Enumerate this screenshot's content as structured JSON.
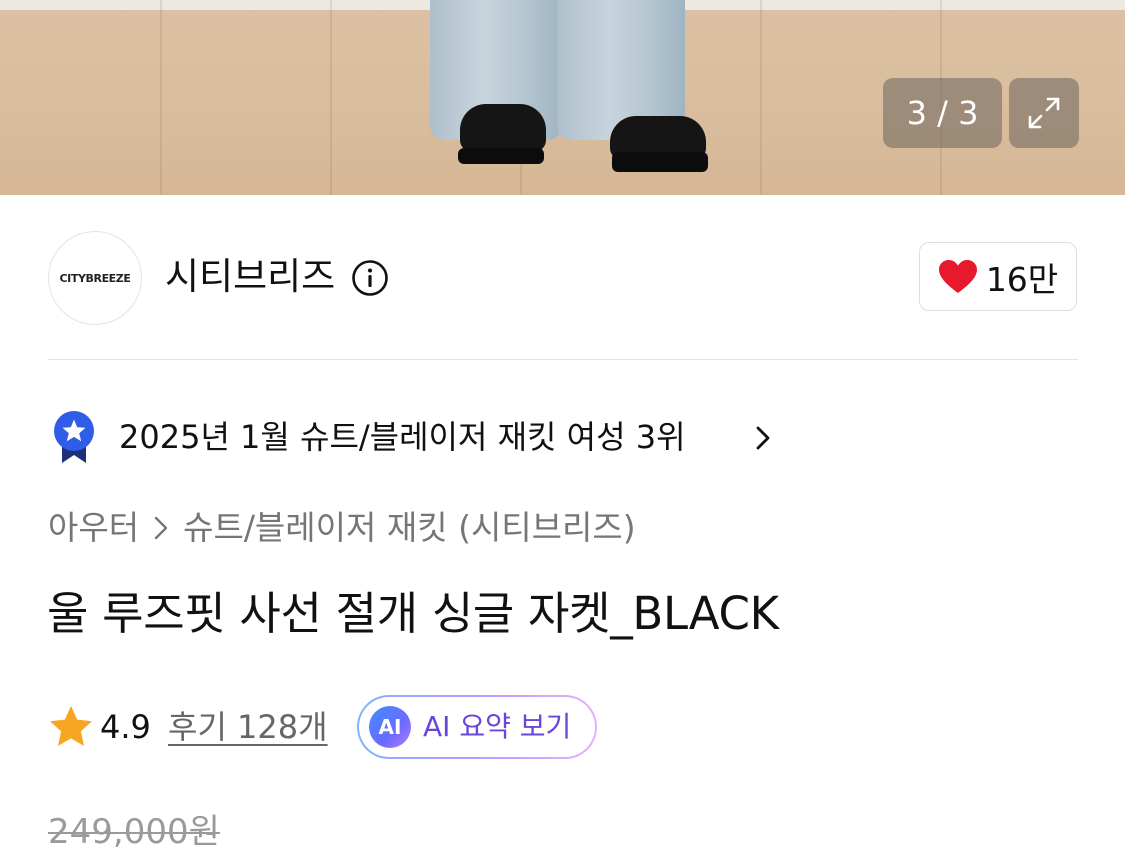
{
  "gallery": {
    "counter": "3 / 3",
    "expand_icon": "expand-icon"
  },
  "brand": {
    "logo_text": "CITYBREEZE",
    "name": "시티브리즈",
    "info_icon": "info-circle-icon",
    "like_icon": "heart-icon",
    "like_count": "16만",
    "like_color": "#e8192c"
  },
  "ranking": {
    "badge_icon": "award-ribbon-icon",
    "badge_color": "#2f5de8",
    "text": "2025년 1월 슈트/블레이저 재킷 여성 3위",
    "chevron_icon": "chevron-right-icon"
  },
  "breadcrumb": {
    "items": [
      "아우터",
      "슈트/블레이저 재킷 (시티브리즈)"
    ],
    "separator_icon": "chevron-right-icon"
  },
  "product": {
    "title": "울 루즈핏 사선 절개 싱글 자켓_BLACK"
  },
  "rating": {
    "star_icon": "star-icon",
    "star_color": "#f5a623",
    "value": "4.9",
    "review_link": "후기 128개",
    "ai_chip": "AI",
    "ai_label": "AI 요약 보기"
  },
  "price": {
    "original": "249,000원"
  }
}
